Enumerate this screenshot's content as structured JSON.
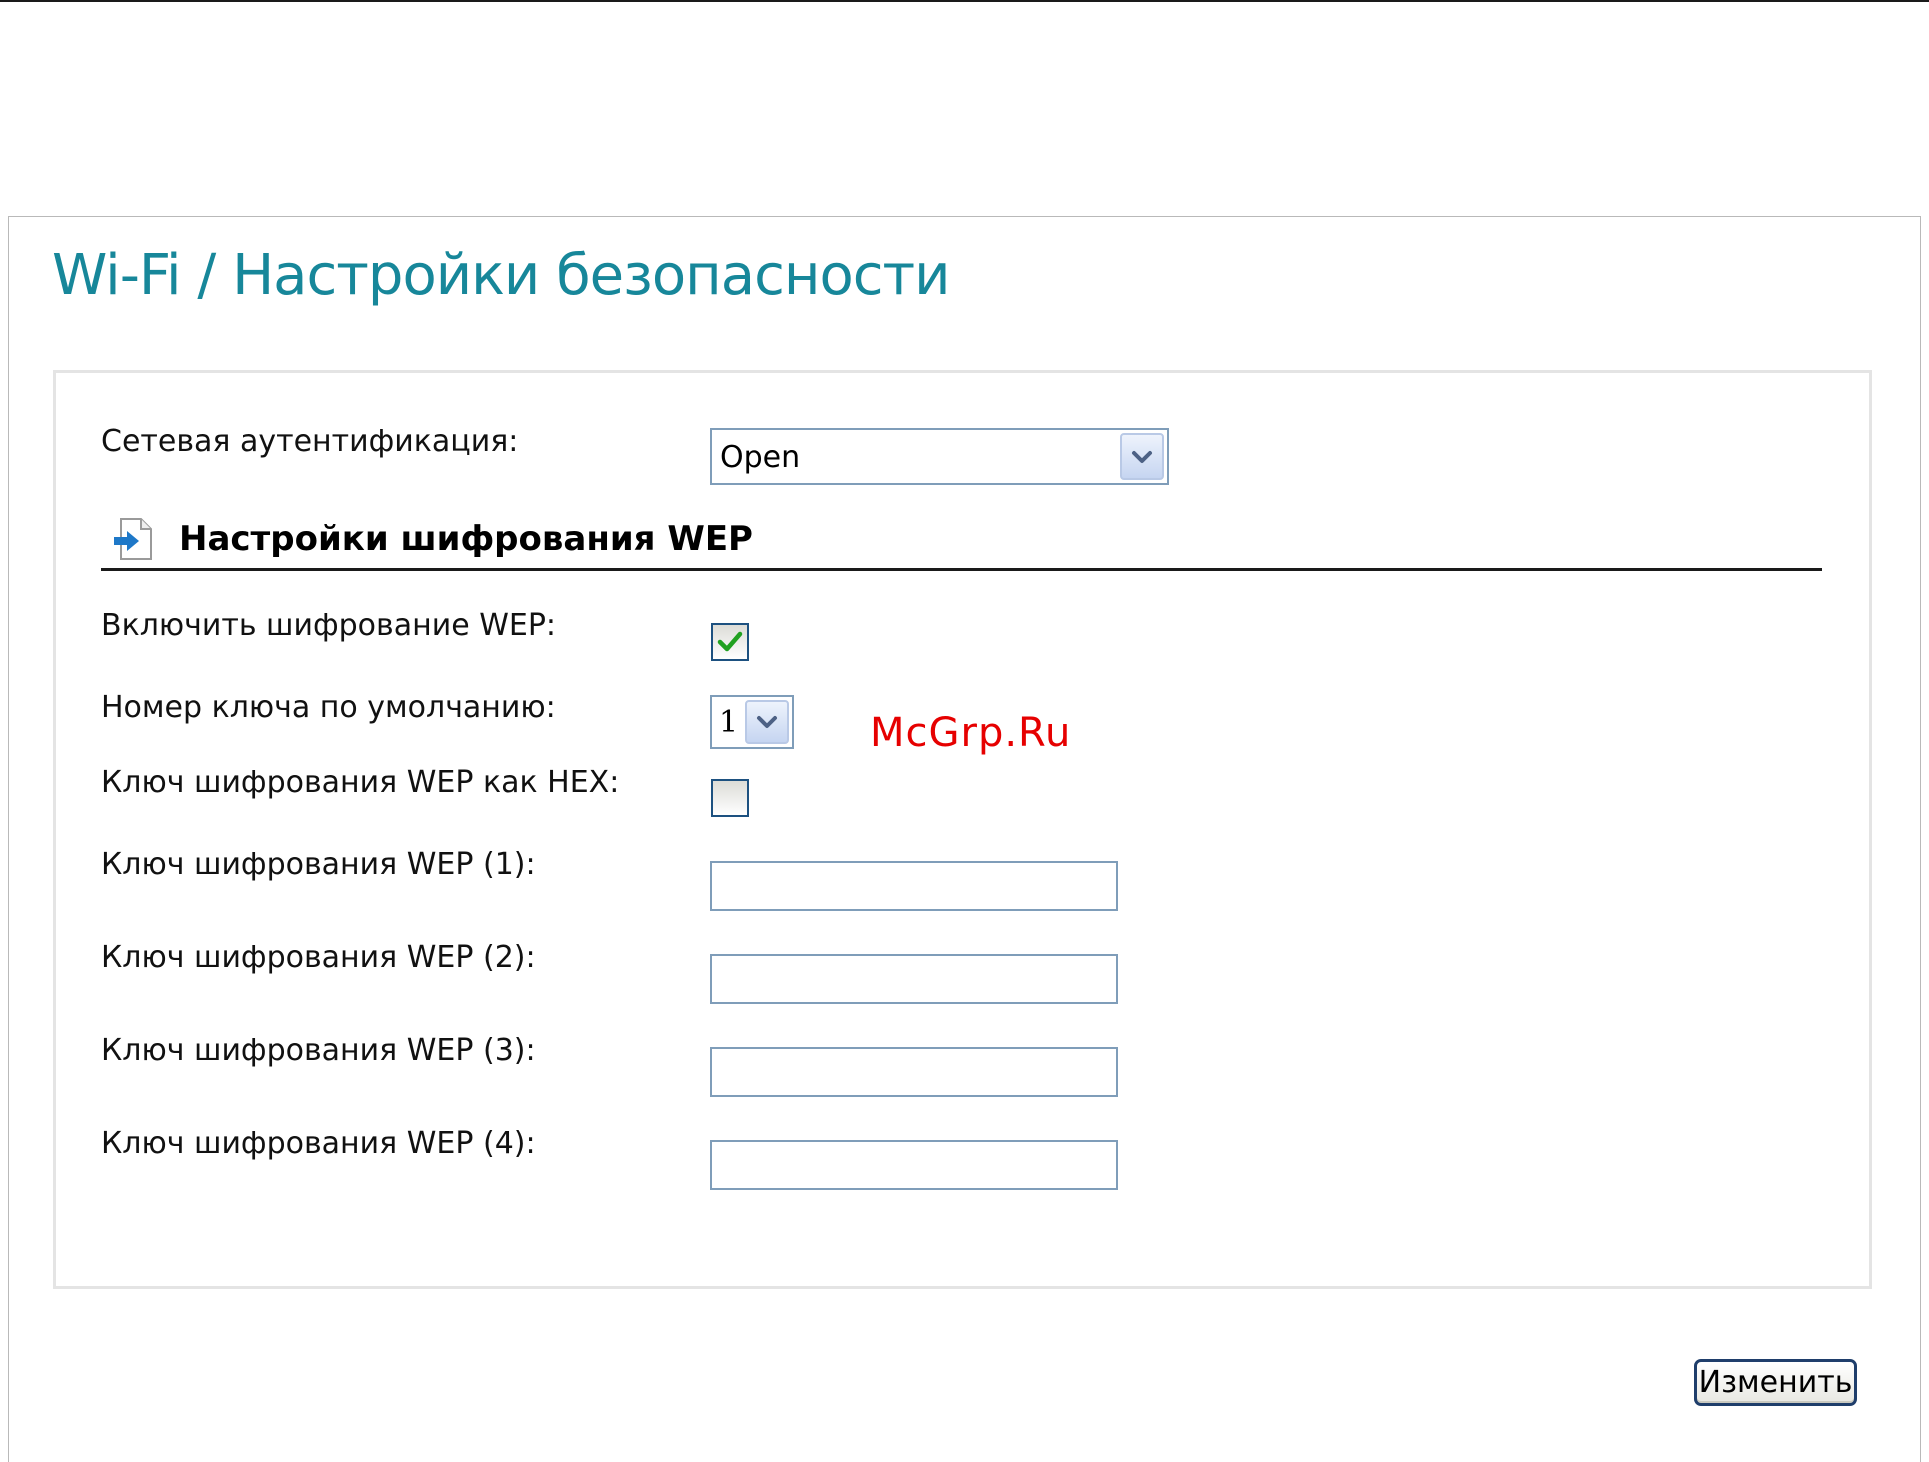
{
  "page": {
    "title": "Wi-Fi / Настройки безопасности"
  },
  "auth": {
    "label": "Сетевая аутентификация:",
    "value": "Open",
    "options": [
      "Open"
    ]
  },
  "wep_section": {
    "title": "Настройки шифрования WEP",
    "icon": "document-arrow-icon"
  },
  "wep": {
    "enable_label": "Включить шифрование WEP:",
    "enable_checked": true,
    "default_key_label": "Номер ключа по умолчанию:",
    "default_key_value": "1",
    "hex_label": "Ключ шифрования WEP как HEX:",
    "hex_checked": false,
    "keys": [
      {
        "label": "Ключ шифрования WEP (1):",
        "value": ""
      },
      {
        "label": "Ключ шифрования WEP (2):",
        "value": ""
      },
      {
        "label": "Ключ шифрования WEP (3):",
        "value": ""
      },
      {
        "label": "Ключ шифрования WEP (4):",
        "value": ""
      }
    ]
  },
  "watermark": "McGrp.Ru",
  "actions": {
    "submit_label": "Изменить"
  },
  "colors": {
    "title": "#17879a",
    "checkmark": "#21a121",
    "watermark": "#e60000",
    "field_border": "#7f9db9"
  }
}
